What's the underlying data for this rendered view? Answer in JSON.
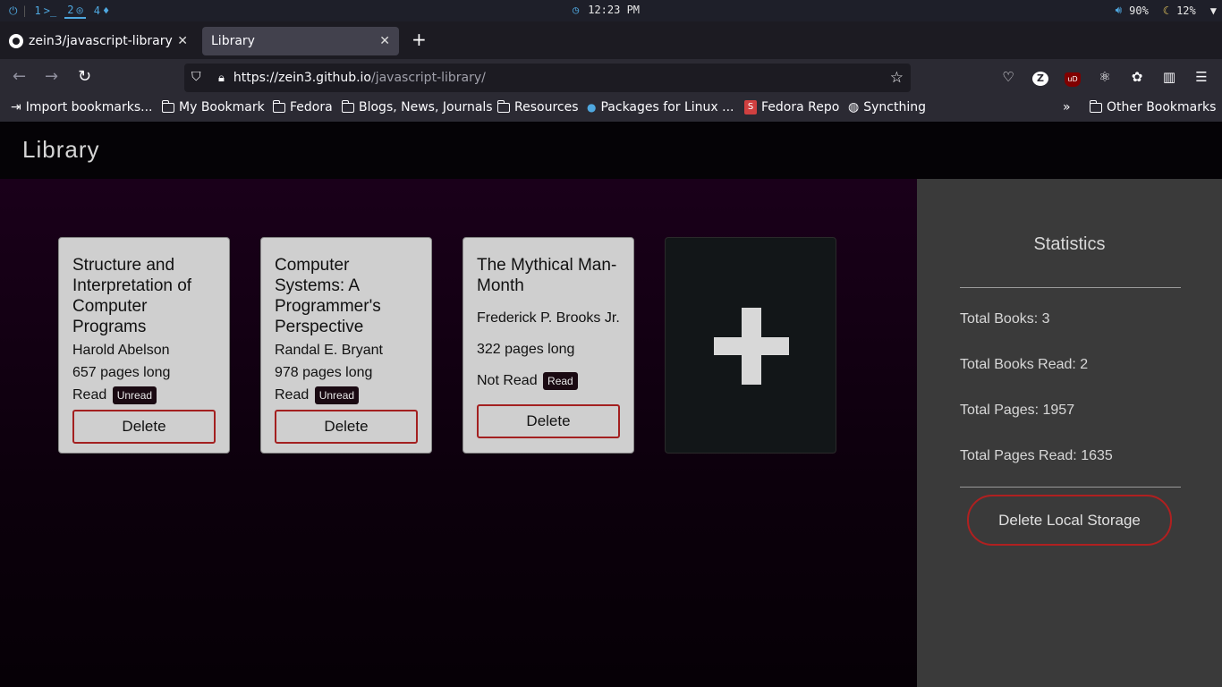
{
  "system_bar": {
    "workspaces": [
      "1",
      "2",
      "4"
    ],
    "clock": "12:23 PM",
    "volume": "90%",
    "brightness": "12%"
  },
  "browser": {
    "tabs": [
      {
        "label": "zein3/javascript-library",
        "active": false
      },
      {
        "label": "Library",
        "active": true
      }
    ],
    "url_host": "https://zein3.github.io",
    "url_path": "/javascript-library/",
    "bookmarks": [
      "Import bookmarks...",
      "My Bookmark",
      "Fedora",
      "Blogs, News, Journals",
      "Resources",
      "Packages for Linux ...",
      "Fedora Repo",
      "Syncthing"
    ],
    "other_bookmarks": "Other Bookmarks"
  },
  "page": {
    "site_title": "Library",
    "books": [
      {
        "title": "Structure and Interpretation of Computer Programs",
        "author": "Harold Abelson",
        "pages": "657 pages long",
        "status": "Read",
        "toggle": "Unread",
        "delete": "Delete"
      },
      {
        "title": "Computer Systems: A Programmer's Perspective",
        "author": "Randal E. Bryant",
        "pages": "978 pages long",
        "status": "Read",
        "toggle": "Unread",
        "delete": "Delete"
      },
      {
        "title": "The Mythical Man-Month",
        "author": "Frederick P. Brooks Jr.",
        "pages": "322 pages long",
        "status": "Not Read",
        "toggle": "Read",
        "delete": "Delete"
      }
    ],
    "add_symbol": "+",
    "stats": {
      "title": "Statistics",
      "total_books": "Total Books: 3",
      "total_books_read": "Total Books Read: 2",
      "total_pages": "Total Pages: 1957",
      "total_pages_read": "Total Pages Read: 1635",
      "delete_storage": "Delete Local Storage"
    }
  },
  "colors": {
    "accent_red": "#a32020",
    "card_bg": "#cfcfcf",
    "sidebar_bg": "#3a3a3a"
  }
}
